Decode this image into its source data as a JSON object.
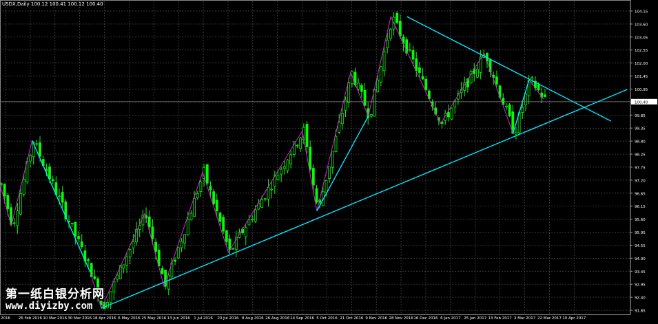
{
  "header": {
    "symbol_line": "USDX,Daily  100.12 100.41 100.12 100.40"
  },
  "watermark": {
    "line1": "第一纸白银分析网",
    "line2": "www.diyizby.com"
  },
  "colors": {
    "background": "#000000",
    "grid": "#4d4d4d",
    "candle_up": "#00ff00",
    "candle_down": "#00ff00",
    "trendline": "#00e5ff",
    "zigzag": "#e020e0",
    "axis_text": "#ffffff",
    "price_label_bg": "#ffffff",
    "price_label_text": "#000000"
  },
  "chart_data": {
    "type": "line",
    "title": "USDX,Daily",
    "ylim": [
      91.65,
      104.3
    ],
    "y_ticks": [
      "104.15",
      "103.60",
      "103.05",
      "102.55",
      "102.00",
      "101.45",
      "100.95",
      "100.40",
      "99.85",
      "99.35",
      "98.80",
      "98.25",
      "97.75",
      "97.20",
      "96.65",
      "96.15",
      "95.60",
      "95.05",
      "94.55",
      "94.00",
      "93.45",
      "92.95",
      "92.40",
      "91.85"
    ],
    "x_ticks": [
      "2016",
      "26 Feb 2016",
      "10 Mar 2016",
      "30 Mar 2016",
      "18 Apr 2016",
      "6 May 2016",
      "25 May 2016",
      "13 Jun 2016",
      "1 Jul 2016",
      "20 Jul 2016",
      "8 Aug 2016",
      "26 Aug 2016",
      "14 Sep 2016",
      "5 Oct 2016",
      "21 Oct 2016",
      "9 Nov 2016",
      "28 Nov 2016",
      "16 Dec 2016",
      "6 Jan 2017",
      "25 Jan 2017",
      "13 Feb 2017",
      "3 Mar 2017",
      "22 Mar 2017",
      "10 Apr 2017"
    ],
    "current_price": "100.40",
    "zigzag_points": [
      [
        0,
        97.0
      ],
      [
        3.5,
        95.3
      ],
      [
        10,
        98.8
      ],
      [
        28,
        93.4
      ],
      [
        31.5,
        91.9
      ],
      [
        45,
        95.8
      ],
      [
        51,
        92.8
      ],
      [
        63,
        97.5
      ],
      [
        71,
        94.2
      ],
      [
        94,
        99.2
      ],
      [
        98.5,
        95.9
      ],
      [
        109,
        101.6
      ],
      [
        114.5,
        99.8
      ],
      [
        121.5,
        103.9
      ],
      [
        137,
        99.5
      ],
      [
        150.5,
        102.4
      ],
      [
        159.5,
        99.1
      ],
      [
        164.5,
        101.3
      ],
      [
        169,
        100.5
      ]
    ],
    "trendlines": [
      {
        "from": [
          31.5,
          91.9
        ],
        "to": [
          195,
          100.9
        ]
      },
      {
        "from": [
          126.5,
          103.9
        ],
        "to": [
          190,
          99.6
        ]
      },
      {
        "from": [
          10,
          98.8
        ],
        "to": [
          28,
          93.4
        ]
      },
      {
        "from": [
          98.5,
          95.9
        ],
        "to": [
          114.5,
          99.8
        ]
      },
      {
        "from": [
          159.5,
          99.1
        ],
        "to": [
          164.5,
          101.3
        ]
      }
    ]
  }
}
